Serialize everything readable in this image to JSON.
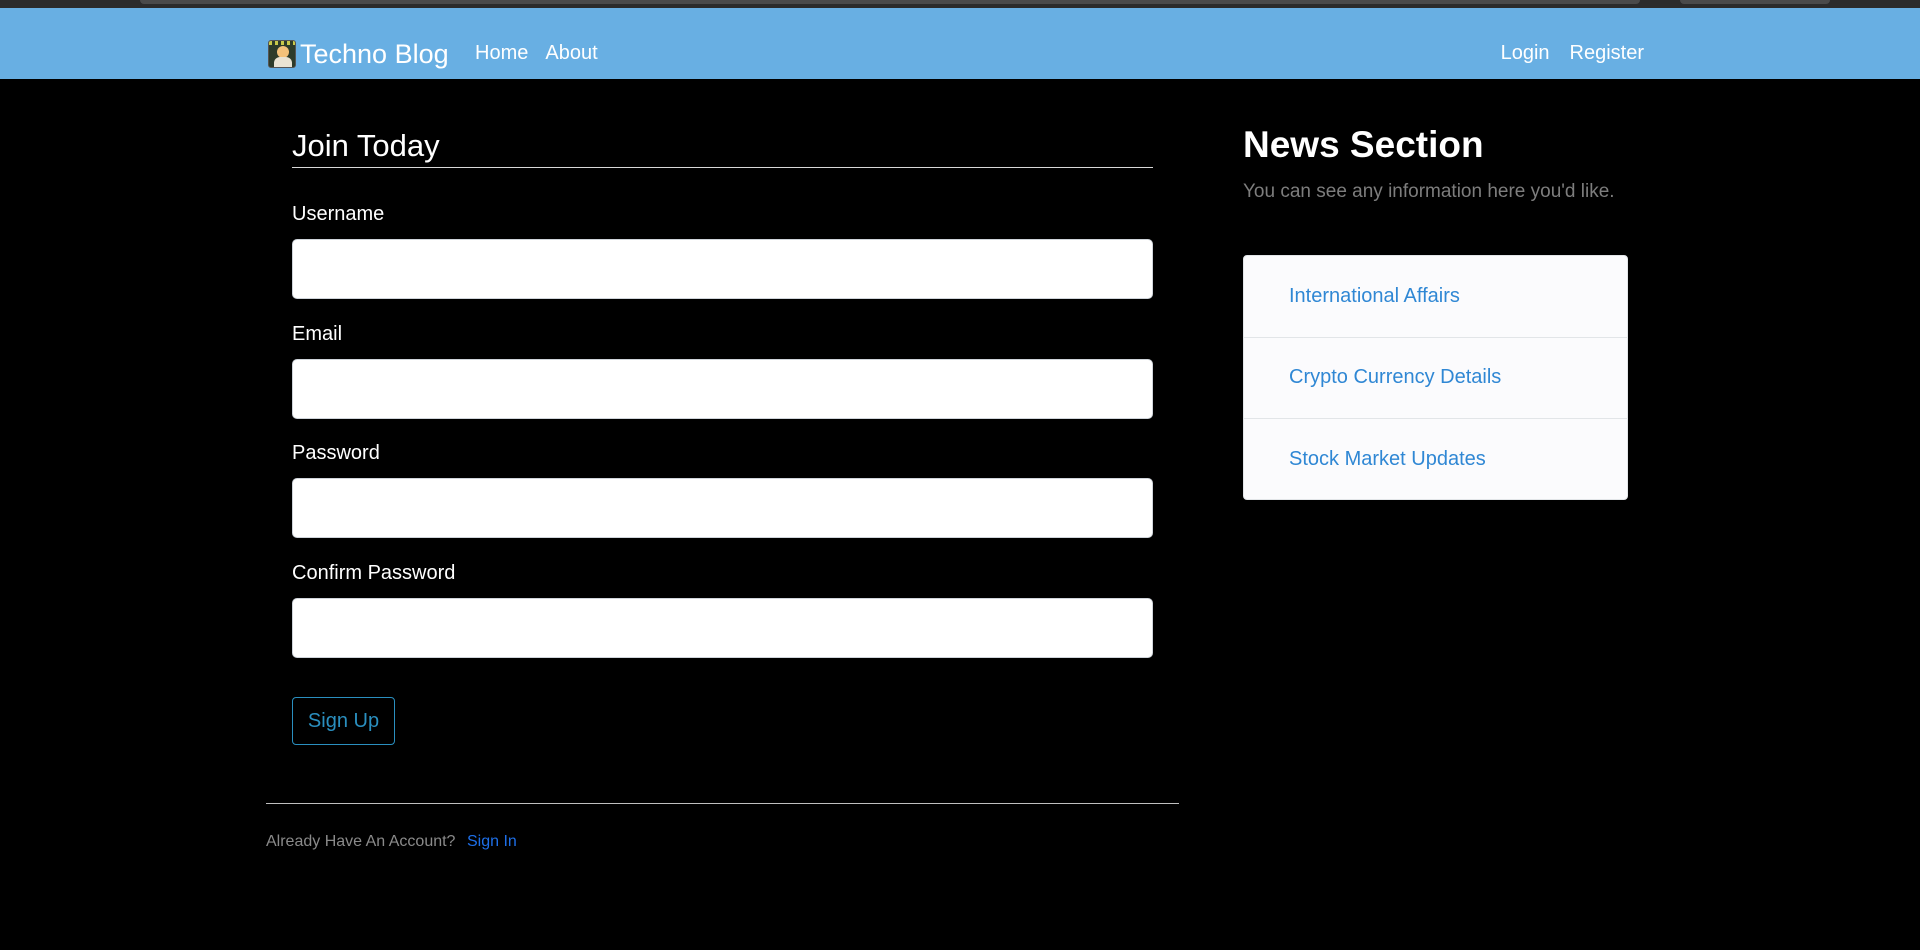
{
  "navbar": {
    "brand_text": "Techno Blog",
    "left_links": [
      "Home",
      "About"
    ],
    "right_links": [
      "Login",
      "Register"
    ],
    "background_color": "#68afe3"
  },
  "form": {
    "title": "Join Today",
    "fields": [
      {
        "label": "Username",
        "value": "",
        "placeholder": ""
      },
      {
        "label": "Email",
        "value": "",
        "placeholder": ""
      },
      {
        "label": "Password",
        "value": "",
        "placeholder": ""
      },
      {
        "label": "Confirm Password",
        "value": "",
        "placeholder": ""
      }
    ],
    "submit_label": "Sign Up",
    "accent_color": "#2a8fbf"
  },
  "footer": {
    "account_prompt": "Already Have An Account?",
    "signin_label": "Sign In"
  },
  "sidebar": {
    "title": "News Section",
    "subtitle": "You can see any information here you'd like.",
    "items": [
      "International Affairs",
      "Crypto Currency Details",
      "Stock Market Updates"
    ],
    "link_color": "#2f87d4"
  }
}
